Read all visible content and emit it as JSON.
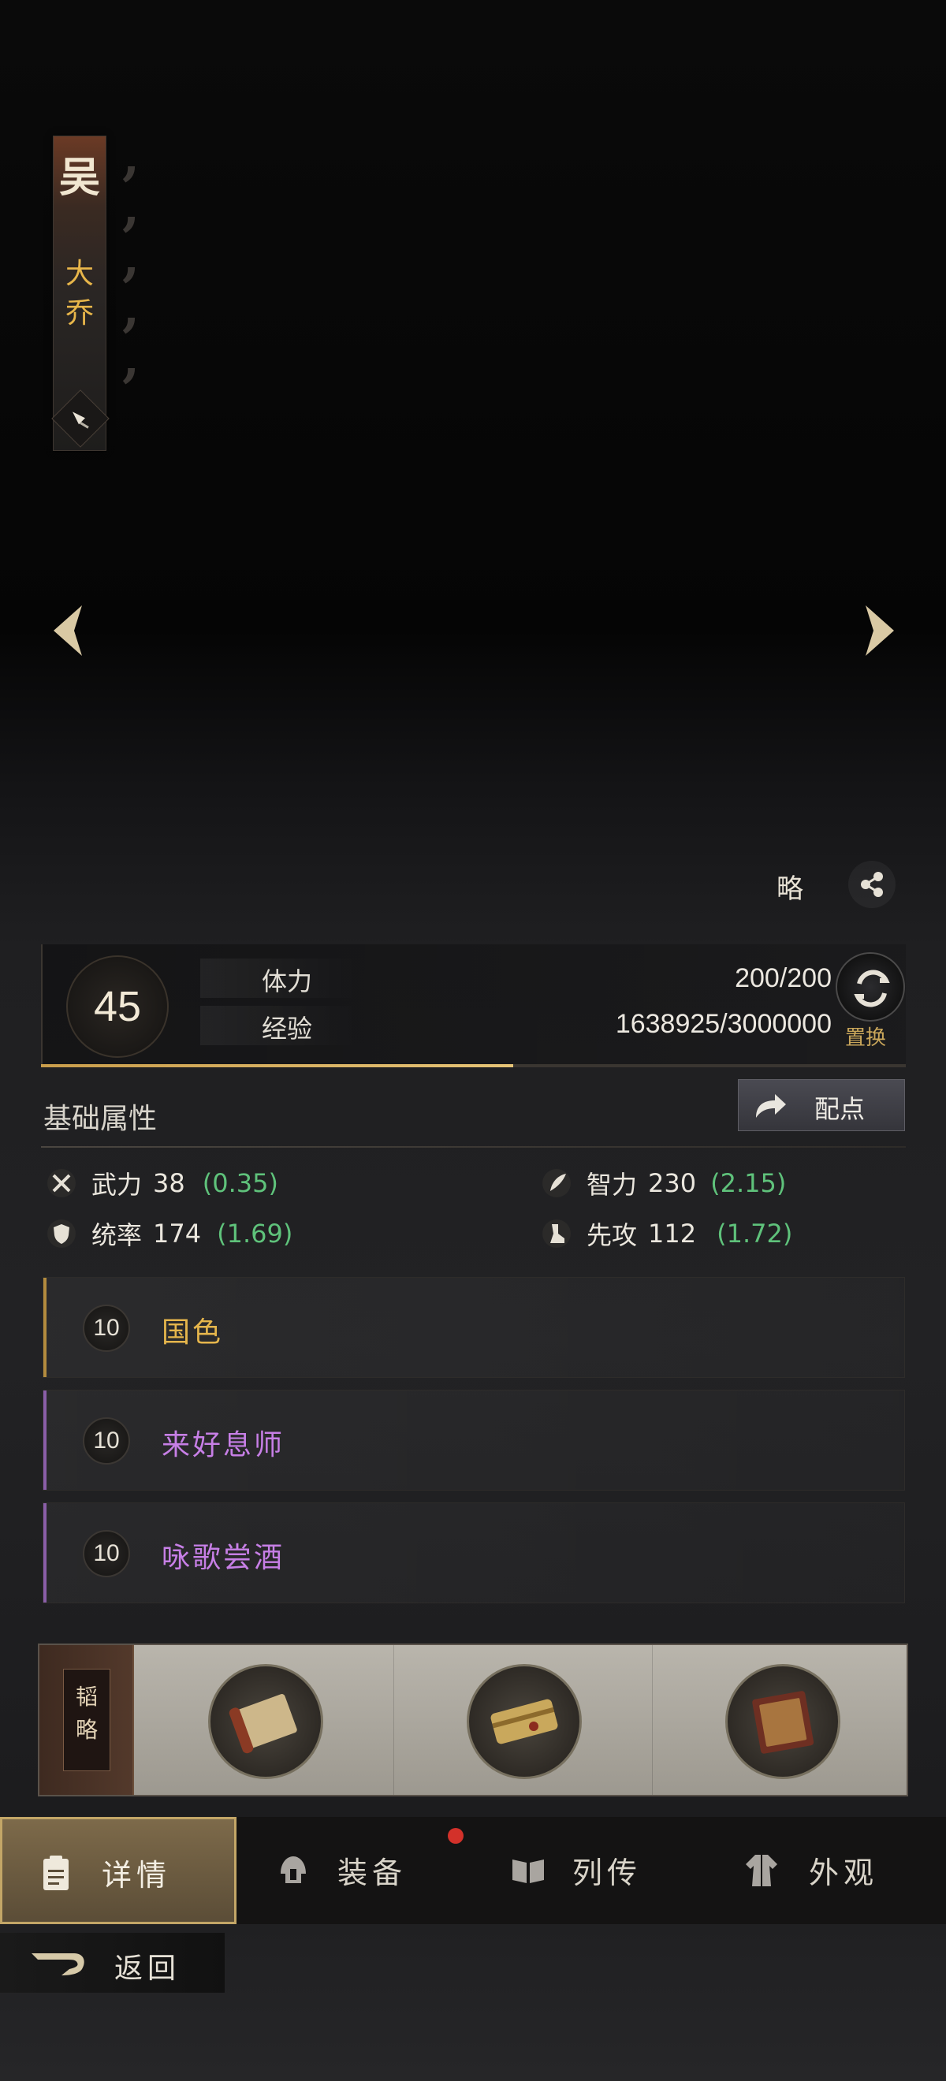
{
  "hero": {
    "faction": "吴",
    "name_line1": "大",
    "name_line2": "乔"
  },
  "strategy_label": "略",
  "level": {
    "value": "45"
  },
  "stats": {
    "stamina_label": "体力",
    "stamina_value": "200/200",
    "exp_label": "经验",
    "exp_value": "1638925/3000000",
    "exp_fraction": 0.546
  },
  "replace_label": "置换",
  "attributes": {
    "title": "基础属性",
    "assign_label": "配点",
    "items": [
      {
        "name": "武力",
        "value": "38",
        "bonus": "(0.35)",
        "icon": "crossed-swords-icon"
      },
      {
        "name": "智力",
        "value": "230",
        "bonus": "(2.15)",
        "icon": "feather-icon"
      },
      {
        "name": "统率",
        "value": "174",
        "bonus": "(1.69)",
        "icon": "shield-icon"
      },
      {
        "name": "先攻",
        "value": "112",
        "bonus": "(1.72)",
        "icon": "boot-icon"
      }
    ]
  },
  "skills": [
    {
      "level": "10",
      "name": "国色",
      "color": "#e6b64c"
    },
    {
      "level": "10",
      "name": "来好息师",
      "color": "#c77fe6"
    },
    {
      "level": "10",
      "name": "咏歌尝酒",
      "color": "#c77fe6"
    }
  ],
  "strategy": {
    "tag_line1": "韬",
    "tag_line2": "略"
  },
  "nav": {
    "tabs": [
      {
        "label": "详情",
        "icon": "clipboard-icon"
      },
      {
        "label": "装备",
        "icon": "helmet-icon"
      },
      {
        "label": "列传",
        "icon": "scroll-book-icon"
      },
      {
        "label": "外观",
        "icon": "robe-icon"
      }
    ]
  },
  "back_label": "返回",
  "colors": {
    "gold": "#e6b64c",
    "purple": "#c77fe6",
    "green": "#5fc27b"
  }
}
